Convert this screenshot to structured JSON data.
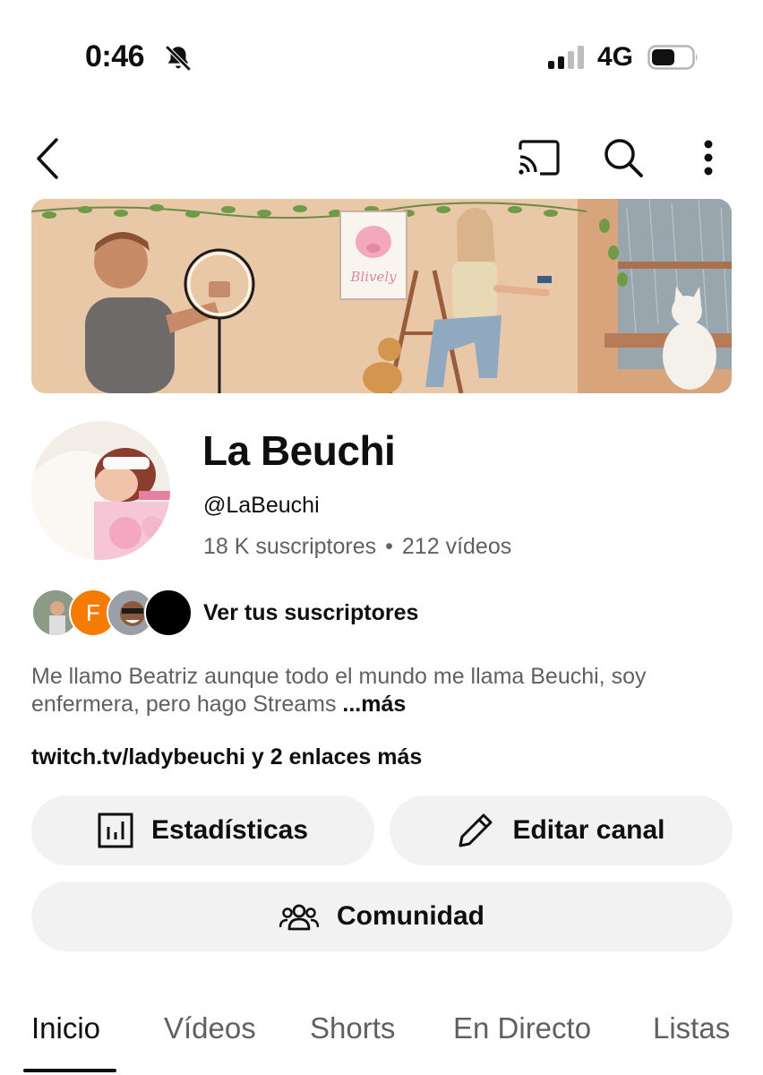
{
  "status_bar": {
    "time": "0:46",
    "network": "4G",
    "icons": [
      "bell-off-icon",
      "signal-icon",
      "battery-icon"
    ]
  },
  "top_bar": {
    "icons": [
      "back-arrow-icon",
      "cast-icon",
      "search-icon",
      "more-vert-icon"
    ]
  },
  "banner": {
    "sign_text": "Blively"
  },
  "channel": {
    "name": "La Beuchi",
    "handle": "@LaBeuchi",
    "subscribers": "18 K suscriptores",
    "separator": "•",
    "videos": "212 vídeos"
  },
  "subscribers_preview": {
    "avatar_letter": "F",
    "label": "Ver tus suscriptores"
  },
  "description": {
    "text": "Me llamo Beatriz aunque todo el mundo me llama Beuchi, soy enfermera, pero hago Streams ",
    "more": "...más"
  },
  "links": {
    "text": "twitch.tv/ladybeuchi y 2 enlaces más"
  },
  "actions": {
    "stats_label": "Estadísticas",
    "edit_label": "Editar canal",
    "community_label": "Comunidad"
  },
  "tabs": {
    "items": [
      {
        "label": "Inicio"
      },
      {
        "label": "Vídeos"
      },
      {
        "label": "Shorts"
      },
      {
        "label": "En Directo"
      },
      {
        "label": "Listas"
      }
    ],
    "active": "Inicio"
  },
  "colors": {
    "text_primary": "#0f0f0f",
    "text_secondary": "#606060",
    "button_bg": "#f2f2f2",
    "accent_orange": "#f57c00"
  }
}
